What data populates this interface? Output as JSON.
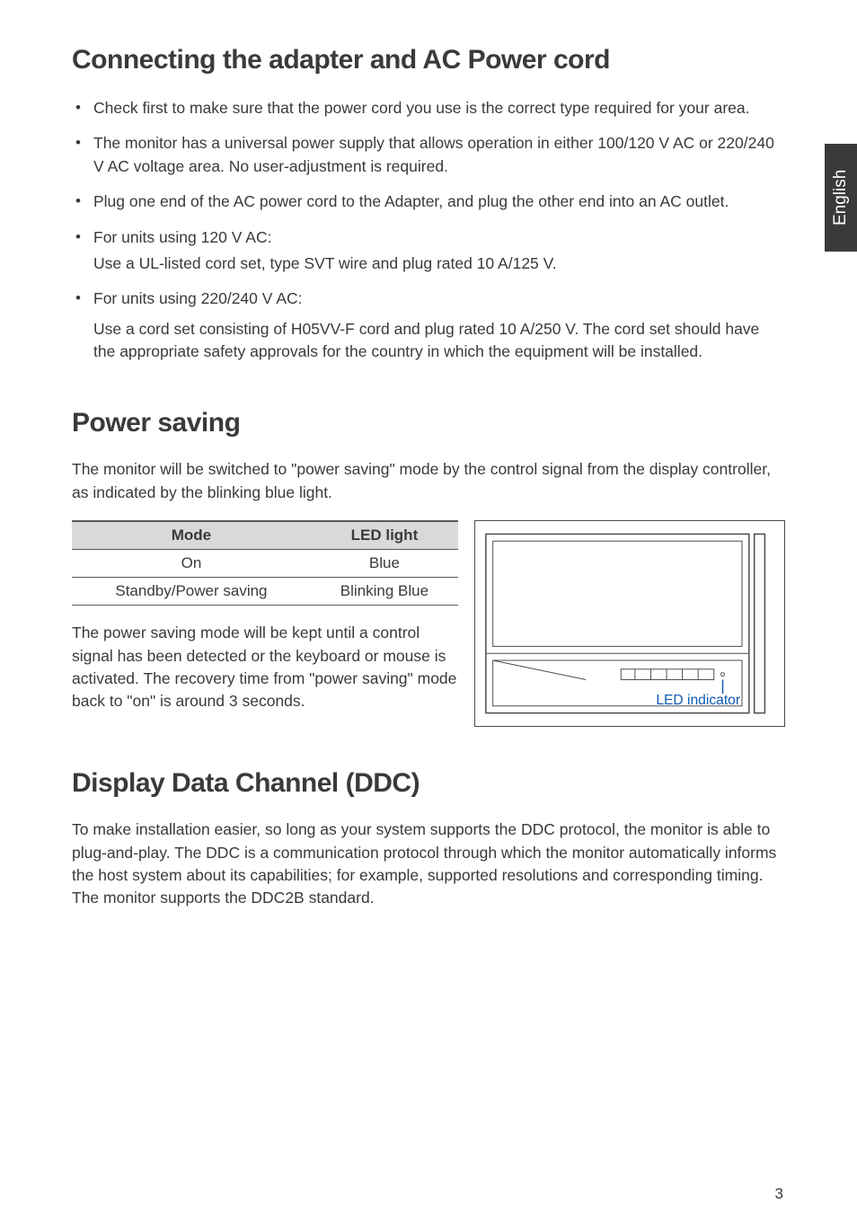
{
  "sideTab": "English",
  "section1": {
    "heading": "Connecting the adapter and AC Power cord",
    "bullets": [
      "Check first to make sure that the power cord you use is the correct type required for your area.",
      "The monitor has a universal power supply that allows operation in either 100/120 V AC or 220/240 V AC voltage area. No user-adjustment is required.",
      "Plug one end of the AC power cord to the Adapter, and plug the other end into an AC outlet.",
      "For units using 120 V AC:",
      "For units using 220/240 V AC:"
    ],
    "sub4": "Use a UL-listed cord set, type SVT wire and plug rated 10 A/125 V.",
    "sub5": "Use a cord set consisting of H05VV-F cord and plug rated 10 A/250 V. The cord set should have the appropriate safety approvals for the country in which the equipment will be installed."
  },
  "section2": {
    "heading": "Power saving",
    "intro": "The monitor will be switched to \"power saving\" mode by the control signal from the display controller, as indicated by the blinking blue light.",
    "table": {
      "headers": {
        "mode": "Mode",
        "led": "LED light"
      },
      "rows": [
        {
          "mode": "On",
          "led": "Blue"
        },
        {
          "mode": "Standby/Power saving",
          "led": "Blinking Blue"
        }
      ]
    },
    "afterTable": "The power saving mode will be kept until a control signal has been detected or the keyboard or mouse is activated. The recovery time from \"power saving\" mode back to \"on\" is around 3 seconds.",
    "diagramLabel": "LED indicator"
  },
  "section3": {
    "heading": "Display Data Channel (DDC)",
    "body": "To make installation easier, so long as your system supports the DDC protocol, the monitor is able to plug-and-play. The DDC is a communication protocol through which the monitor automatically informs the host system about its capabilities; for example, supported resolutions and corresponding timing. The monitor supports the DDC2B standard."
  },
  "pageNumber": "3"
}
